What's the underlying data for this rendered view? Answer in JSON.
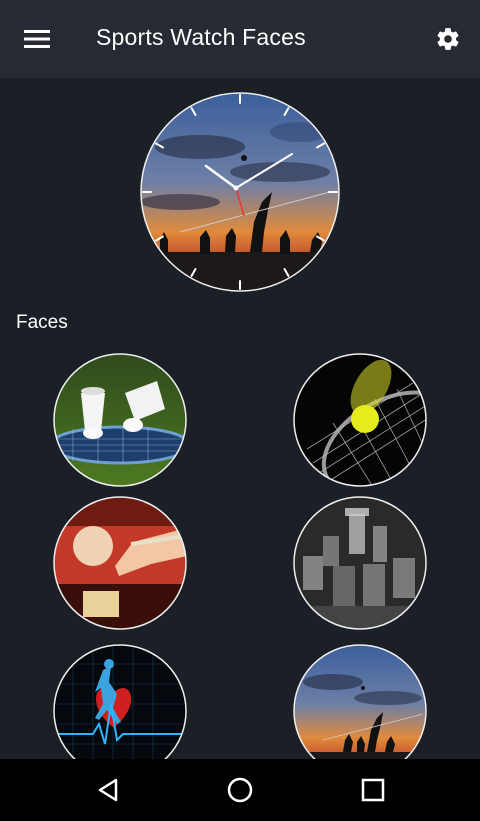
{
  "app_bar": {
    "title": "Sports Watch Faces",
    "menu_icon": "hamburger-menu-icon",
    "settings_icon": "gear-icon"
  },
  "preview": {
    "image": "sunset-volleyball-watch-face"
  },
  "section": {
    "label": "Faces"
  },
  "faces": [
    {
      "image": "badminton-shuttlecocks"
    },
    {
      "image": "tennis-ball-racket"
    },
    {
      "image": "billiards-cue-ball"
    },
    {
      "image": "chess-pieces"
    },
    {
      "image": "heartbeat-runner"
    },
    {
      "image": "sunset-volleyball"
    }
  ],
  "nav_bar": {
    "back_icon": "back-triangle-icon",
    "home_icon": "home-circle-icon",
    "recent_icon": "recent-apps-square-icon"
  },
  "colors": {
    "background": "#1b1f26",
    "app_bar": "#262b33",
    "nav_bar": "#000000",
    "text": "#ffffff"
  }
}
